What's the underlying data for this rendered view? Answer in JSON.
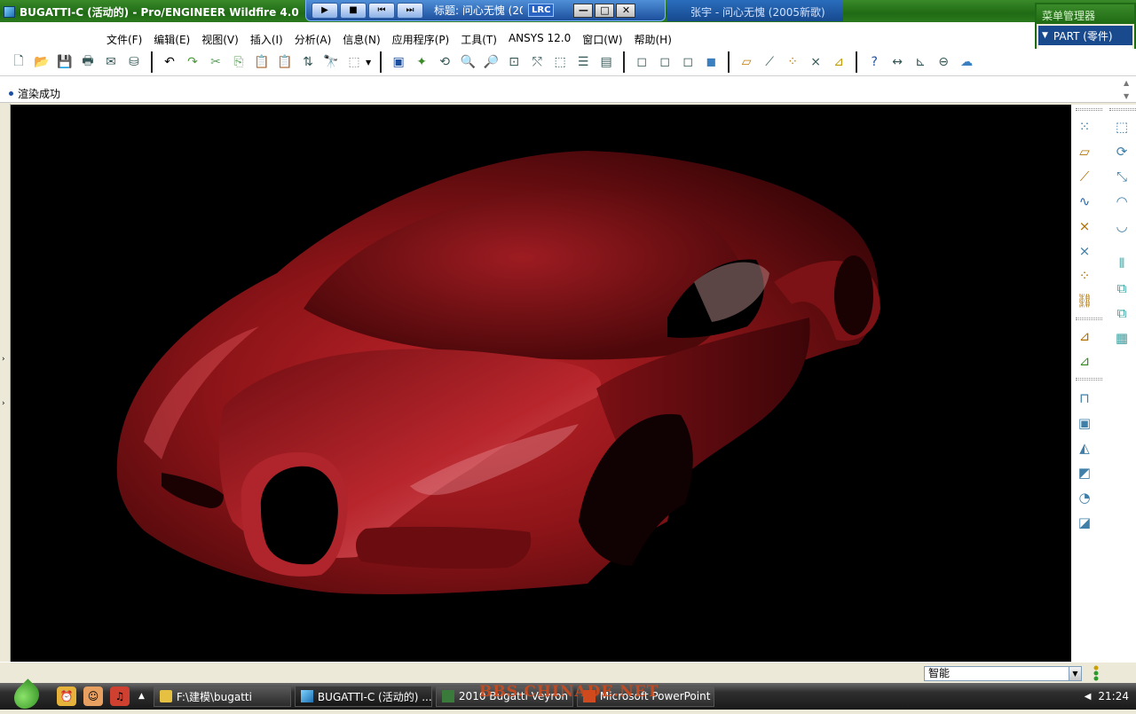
{
  "window": {
    "title": "BUGATTI-C (活动的) - Pro/ENGINEER Wildfire 4.0"
  },
  "lrc_player": {
    "title": "标题: 问心无愧 (20",
    "tag": "LRC",
    "next_song": "张宇 - 问心无愧 (2005新歌)"
  },
  "menu_manager": {
    "header": "菜单管理器",
    "item": "PART (零件)"
  },
  "menubar": {
    "items": [
      "文件(F)",
      "编辑(E)",
      "视图(V)",
      "插入(I)",
      "分析(A)",
      "信息(N)",
      "应用程序(P)",
      "工具(T)",
      "ANSYS 12.0",
      "窗口(W)",
      "帮助(H)"
    ]
  },
  "message": {
    "text": "渲染成功"
  },
  "status": {
    "filter_value": "智能"
  },
  "taskbar": {
    "tasks": [
      {
        "label": "F:\\建模\\bugatti",
        "icon": "folder-icon"
      },
      {
        "label": "BUGATTI-C (活动的) ...",
        "icon": "proe-icon"
      },
      {
        "label": "2010 Bugatti Veyron ...",
        "icon": "image-icon"
      },
      {
        "label": "Microsoft PowerPoint ...",
        "icon": "powerpoint-icon"
      }
    ],
    "watermark": "BBS.CHINADE.NET",
    "clock": "21:24"
  },
  "colors": {
    "titlebar": "#2b7a1d",
    "car_body": "#8c1418",
    "viewport_bg": "#000000",
    "menu_highlight": "#1a4a8e"
  }
}
